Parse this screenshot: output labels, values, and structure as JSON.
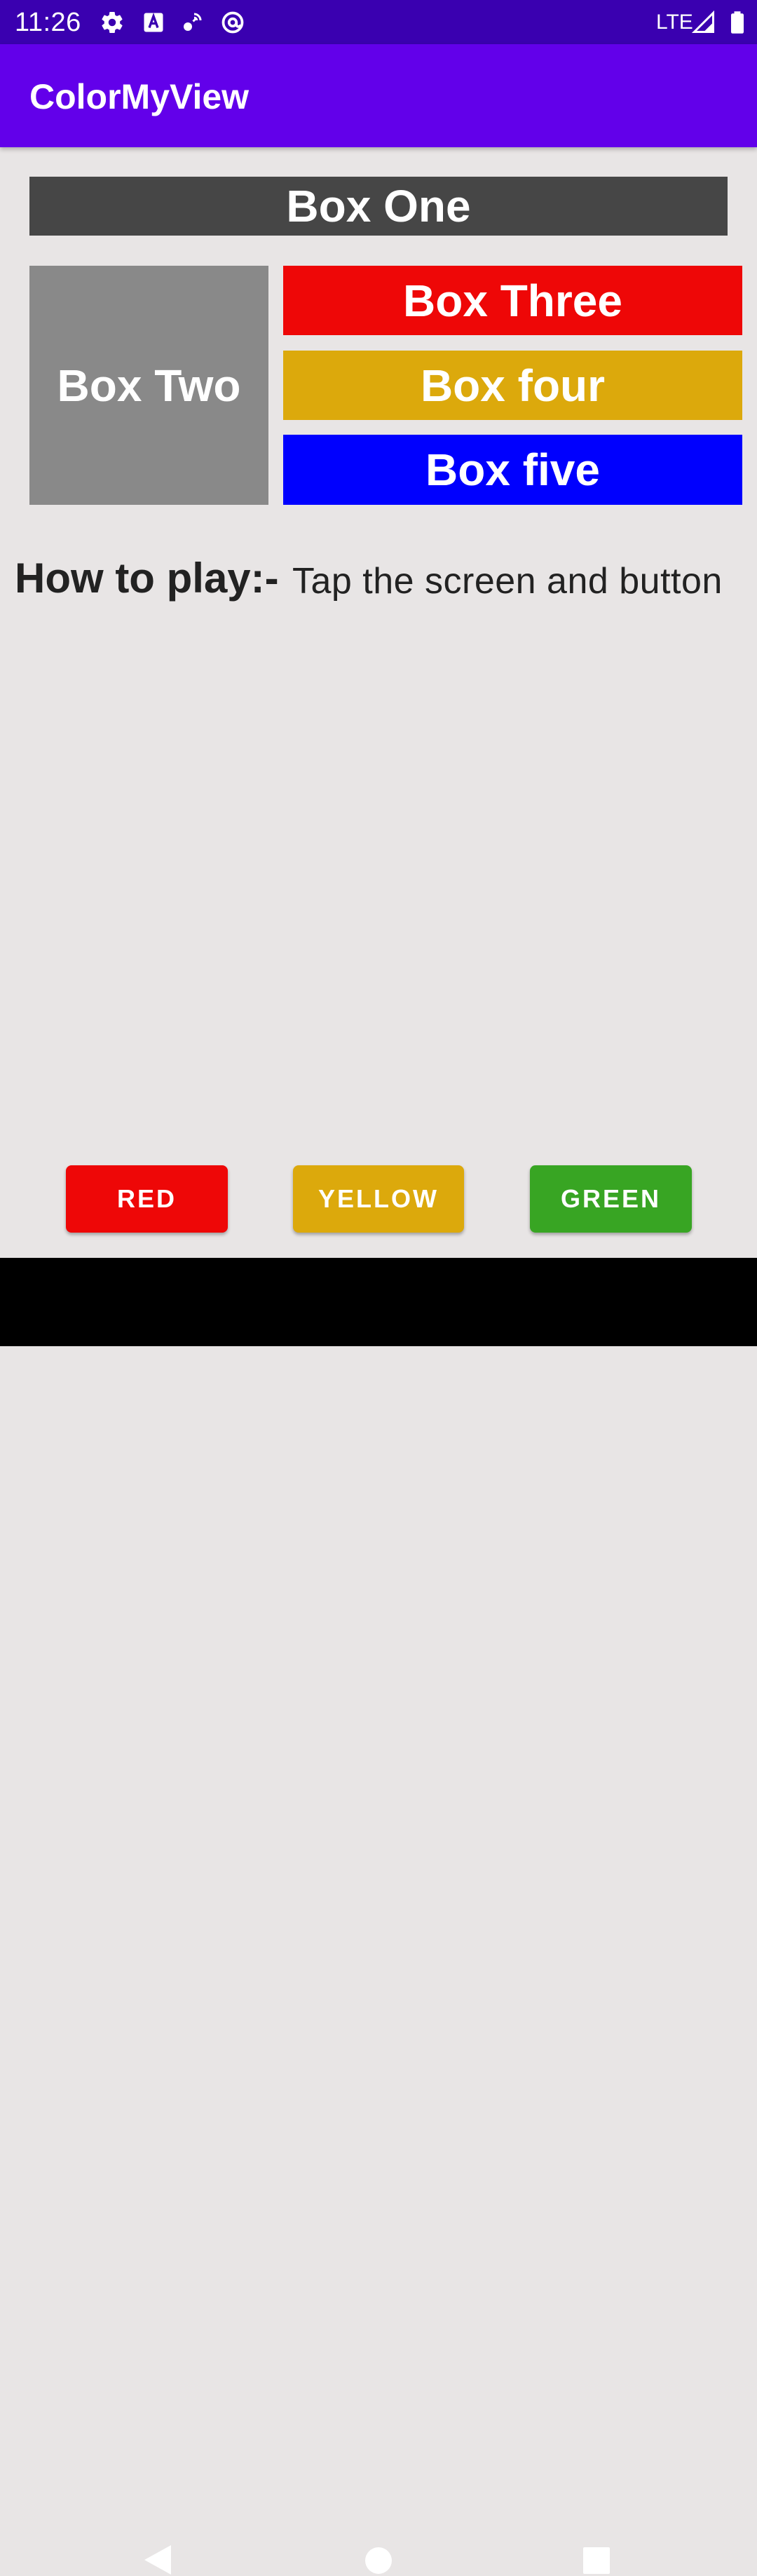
{
  "status_bar": {
    "time": "11:26",
    "network": "LTE",
    "icons": [
      "gear-icon",
      "a-badge-icon",
      "satellite-icon",
      "at-icon",
      "signal-icon",
      "battery-icon"
    ]
  },
  "app_bar": {
    "title": "ColorMyView",
    "color": "#6200ea"
  },
  "boxes": {
    "one": {
      "label": "Box One",
      "color": "#464646"
    },
    "two": {
      "label": "Box Two",
      "color": "#898989"
    },
    "three": {
      "label": "Box Three",
      "color": "#ee0707"
    },
    "four": {
      "label": "Box four",
      "color": "#dca90c"
    },
    "five": {
      "label": "Box five",
      "color": "#0000fe"
    }
  },
  "instructions": {
    "label": "How to play:-",
    "text": "Tap the screen and button"
  },
  "buttons": {
    "red": {
      "label": "RED",
      "color": "#ee0707"
    },
    "yellow": {
      "label": "YELLOW",
      "color": "#dca90c"
    },
    "green": {
      "label": "GREEN",
      "color": "#38a523"
    }
  },
  "nav_bar": {
    "icons": [
      "back-icon",
      "home-icon",
      "recents-icon"
    ]
  }
}
